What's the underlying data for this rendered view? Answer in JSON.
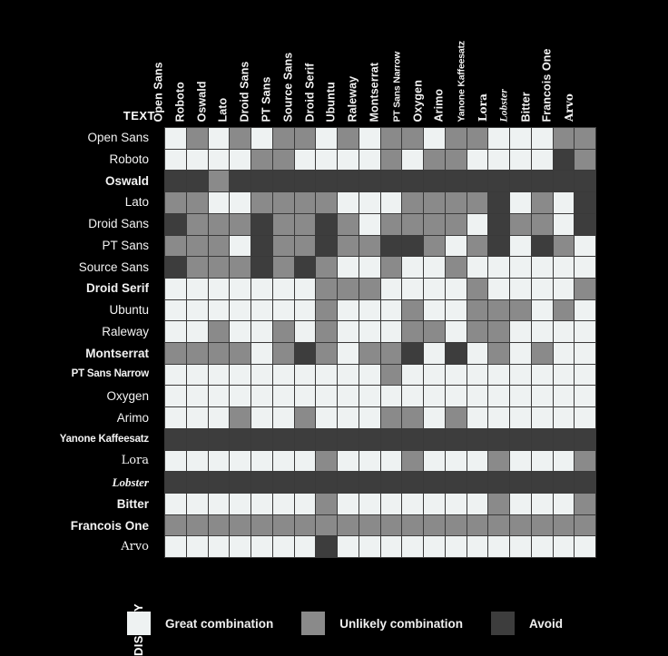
{
  "axes": {
    "x_axis_label": "DISPLAY",
    "y_axis_label": "TEXT"
  },
  "legend": {
    "items": [
      {
        "label": "Great combination",
        "color": "#eef2f2",
        "key": "great"
      },
      {
        "label": "Unlikely combination",
        "color": "#8a8a8a",
        "key": "unlikely"
      },
      {
        "label": "Avoid",
        "color": "#3d3d3d",
        "key": "avoid"
      }
    ]
  },
  "colors": {
    "background": "#000000",
    "great": "#eef2f2",
    "unlikely": "#8a8a8a",
    "avoid": "#3d3d3d",
    "gridline": "#3a3a3a",
    "text": "#f2f2f2"
  },
  "chart_data": {
    "type": "heatmap",
    "title": "",
    "xlabel": "DISPLAY",
    "ylabel": "TEXT",
    "grid": true,
    "legend_position": "bottom",
    "value_scale": [
      {
        "value": "great",
        "label": "Great combination",
        "color": "#eef2f2"
      },
      {
        "value": "unlikely",
        "label": "Unlikely combination",
        "color": "#8a8a8a"
      },
      {
        "value": "avoid",
        "label": "Avoid",
        "color": "#3d3d3d"
      }
    ],
    "columns": [
      "Open Sans",
      "Roboto",
      "Oswald",
      "Lato",
      "Droid Sans",
      "PT Sans",
      "Source Sans",
      "Droid Serif",
      "Ubuntu",
      "Raleway",
      "Montserrat",
      "PT Sans Narrow",
      "Oxygen",
      "Arimo",
      "Yanone Kaffeesatz",
      "Lora",
      "Lobster",
      "Bitter",
      "Francois One",
      "Arvo"
    ],
    "rows": [
      "Open Sans",
      "Roboto",
      "Oswald",
      "Lato",
      "Droid Sans",
      "PT Sans",
      "Source Sans",
      "Droid Serif",
      "Ubuntu",
      "Raleway",
      "Montserrat",
      "PT Sans Narrow",
      "Oxygen",
      "Arimo",
      "Yanone Kaffeesatz",
      "Lora",
      "Lobster",
      "Bitter",
      "Francois One",
      "Arvo"
    ],
    "values": [
      [
        "great",
        "unlikely",
        "great",
        "unlikely",
        "great",
        "unlikely",
        "unlikely",
        "great",
        "unlikely",
        "great",
        "unlikely",
        "unlikely",
        "great",
        "unlikely",
        "unlikely",
        "great",
        "great",
        "great",
        "unlikely",
        "unlikely"
      ],
      [
        "great",
        "great",
        "great",
        "great",
        "unlikely",
        "unlikely",
        "great",
        "great",
        "great",
        "great",
        "unlikely",
        "great",
        "unlikely",
        "unlikely",
        "great",
        "great",
        "great",
        "great",
        "avoid",
        "unlikely"
      ],
      [
        "avoid",
        "avoid",
        "unlikely",
        "avoid",
        "avoid",
        "avoid",
        "avoid",
        "avoid",
        "avoid",
        "avoid",
        "avoid",
        "avoid",
        "avoid",
        "avoid",
        "avoid",
        "avoid",
        "avoid",
        "avoid",
        "avoid",
        "avoid"
      ],
      [
        "unlikely",
        "unlikely",
        "great",
        "great",
        "unlikely",
        "unlikely",
        "unlikely",
        "unlikely",
        "great",
        "great",
        "great",
        "unlikely",
        "unlikely",
        "unlikely",
        "unlikely",
        "avoid",
        "great",
        "unlikely",
        "great",
        "avoid"
      ],
      [
        "avoid",
        "unlikely",
        "unlikely",
        "unlikely",
        "avoid",
        "unlikely",
        "unlikely",
        "avoid",
        "unlikely",
        "great",
        "unlikely",
        "unlikely",
        "unlikely",
        "unlikely",
        "great",
        "avoid",
        "unlikely",
        "unlikely",
        "great",
        "avoid"
      ],
      [
        "unlikely",
        "unlikely",
        "unlikely",
        "great",
        "avoid",
        "unlikely",
        "unlikely",
        "avoid",
        "unlikely",
        "unlikely",
        "avoid",
        "avoid",
        "unlikely",
        "great",
        "unlikely",
        "avoid",
        "great",
        "avoid",
        "unlikely",
        "great"
      ],
      [
        "avoid",
        "unlikely",
        "unlikely",
        "unlikely",
        "avoid",
        "unlikely",
        "avoid",
        "unlikely",
        "great",
        "great",
        "unlikely",
        "great",
        "great",
        "unlikely",
        "great",
        "great",
        "great",
        "great",
        "great",
        "great"
      ],
      [
        "great",
        "great",
        "great",
        "great",
        "great",
        "great",
        "great",
        "unlikely",
        "unlikely",
        "unlikely",
        "great",
        "great",
        "great",
        "great",
        "unlikely",
        "great",
        "great",
        "great",
        "great",
        "unlikely"
      ],
      [
        "great",
        "great",
        "great",
        "great",
        "great",
        "great",
        "great",
        "unlikely",
        "great",
        "great",
        "great",
        "unlikely",
        "great",
        "great",
        "unlikely",
        "unlikely",
        "unlikely",
        "great",
        "unlikely",
        "great"
      ],
      [
        "great",
        "great",
        "unlikely",
        "great",
        "great",
        "unlikely",
        "great",
        "unlikely",
        "great",
        "great",
        "great",
        "unlikely",
        "unlikely",
        "great",
        "unlikely",
        "unlikely",
        "great",
        "great",
        "great",
        "great"
      ],
      [
        "unlikely",
        "unlikely",
        "unlikely",
        "unlikely",
        "great",
        "unlikely",
        "avoid",
        "unlikely",
        "great",
        "unlikely",
        "unlikely",
        "avoid",
        "great",
        "avoid",
        "great",
        "unlikely",
        "great",
        "unlikely",
        "great",
        "great"
      ],
      [
        "great",
        "great",
        "great",
        "great",
        "great",
        "great",
        "great",
        "great",
        "great",
        "great",
        "unlikely",
        "great",
        "great",
        "great",
        "great",
        "great",
        "great",
        "great",
        "great",
        "great"
      ],
      [
        "great",
        "great",
        "great",
        "great",
        "great",
        "great",
        "great",
        "great",
        "great",
        "great",
        "great",
        "great",
        "great",
        "great",
        "great",
        "great",
        "great",
        "great",
        "great",
        "great"
      ],
      [
        "great",
        "great",
        "great",
        "unlikely",
        "great",
        "great",
        "unlikely",
        "great",
        "great",
        "great",
        "unlikely",
        "unlikely",
        "great",
        "unlikely",
        "great",
        "great",
        "great",
        "great",
        "great",
        "great"
      ],
      [
        "avoid",
        "avoid",
        "avoid",
        "avoid",
        "avoid",
        "avoid",
        "avoid",
        "avoid",
        "avoid",
        "avoid",
        "avoid",
        "avoid",
        "avoid",
        "avoid",
        "avoid",
        "avoid",
        "avoid",
        "avoid",
        "avoid",
        "avoid"
      ],
      [
        "great",
        "great",
        "great",
        "great",
        "great",
        "great",
        "great",
        "unlikely",
        "great",
        "great",
        "great",
        "unlikely",
        "great",
        "great",
        "great",
        "unlikely",
        "great",
        "great",
        "great",
        "unlikely"
      ],
      [
        "avoid",
        "avoid",
        "avoid",
        "avoid",
        "avoid",
        "avoid",
        "avoid",
        "avoid",
        "avoid",
        "avoid",
        "avoid",
        "avoid",
        "avoid",
        "avoid",
        "avoid",
        "avoid",
        "avoid",
        "avoid",
        "avoid",
        "avoid"
      ],
      [
        "great",
        "great",
        "great",
        "great",
        "great",
        "great",
        "great",
        "unlikely",
        "great",
        "great",
        "great",
        "great",
        "great",
        "great",
        "great",
        "unlikely",
        "great",
        "great",
        "great",
        "unlikely"
      ],
      [
        "unlikely",
        "unlikely",
        "unlikely",
        "unlikely",
        "unlikely",
        "unlikely",
        "unlikely",
        "unlikely",
        "unlikely",
        "unlikely",
        "unlikely",
        "unlikely",
        "unlikely",
        "unlikely",
        "unlikely",
        "unlikely",
        "unlikely",
        "unlikely",
        "unlikely",
        "unlikely"
      ],
      [
        "great",
        "great",
        "great",
        "great",
        "great",
        "great",
        "great",
        "avoid",
        "great",
        "great",
        "great",
        "great",
        "great",
        "great",
        "great",
        "great",
        "great",
        "great",
        "great",
        "great"
      ]
    ]
  },
  "row_styles": [
    "plain",
    "plain",
    "bold",
    "plain",
    "plain",
    "plain",
    "plain",
    "bold",
    "plain",
    "plain",
    "bold",
    "narrow",
    "plain",
    "plain",
    "narrow",
    "serifrow",
    "script",
    "bold",
    "bold",
    "serifrow"
  ],
  "col_styles": [
    "plain",
    "plain",
    "bold",
    "plain",
    "plain",
    "plain",
    "plain",
    "bold",
    "plain",
    "plain",
    "bold",
    "narrow",
    "plain",
    "plain",
    "narrow",
    "serifrow",
    "script",
    "bold",
    "bold",
    "serifrow"
  ]
}
